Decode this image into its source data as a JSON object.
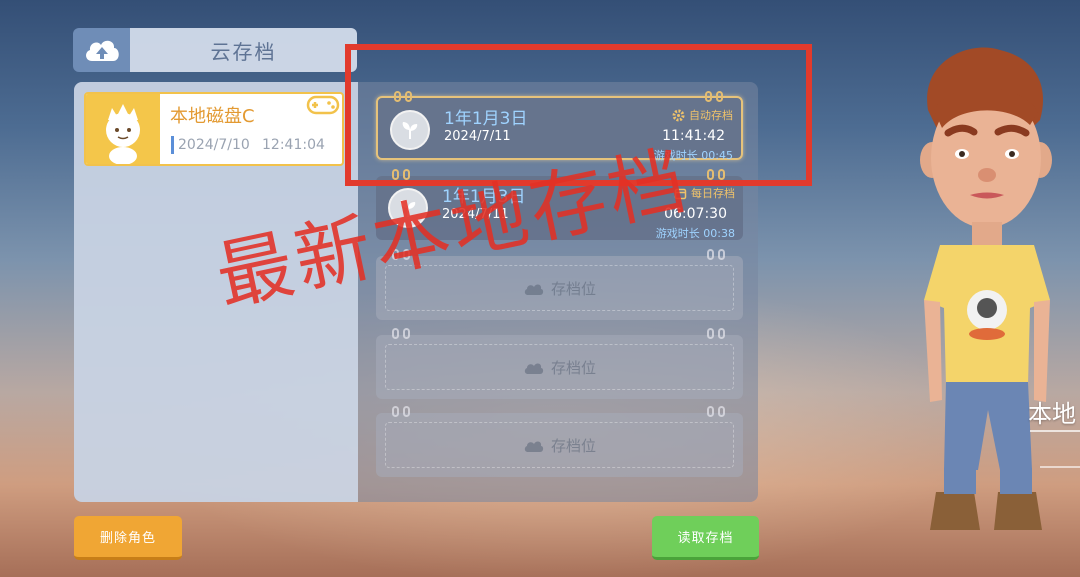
{
  "header": {
    "cloud_icon": "cloud-upload-icon",
    "title": "云存档"
  },
  "role": {
    "name": "本地磁盘C",
    "date": "2024/7/10",
    "time": "12:41:04",
    "avatar_icon": "character-avatar-icon",
    "gamepad_icon": "gamepad-icon"
  },
  "slots": [
    {
      "title": "1年1月3日",
      "date": "2024/7/11",
      "tag": "自动存档",
      "time": "11:41:42",
      "duration": "游戏时长 00:45",
      "icon": "sprout-icon"
    },
    {
      "title": "1年1月3日",
      "date": "2024/7/11",
      "tag": "每日存档",
      "time": "06:07:30",
      "duration": "游戏时长 00:38",
      "icon": "sprout-icon"
    },
    {
      "label": "存档位",
      "icon": "cloud-icon"
    },
    {
      "label": "存档位",
      "icon": "cloud-icon"
    },
    {
      "label": "存档位",
      "icon": "cloud-icon"
    }
  ],
  "buttons": {
    "delete_label": "删除角色",
    "load_label": "读取存档"
  },
  "annotation": {
    "caption": "最新本地存档",
    "color": "#e23a2c"
  },
  "side_label": "本地",
  "colors": {
    "accent_orange": "#f0a634",
    "accent_green": "#6fcf5a",
    "title_blue": "#9fd3ff",
    "gold": "#f0c36a"
  }
}
